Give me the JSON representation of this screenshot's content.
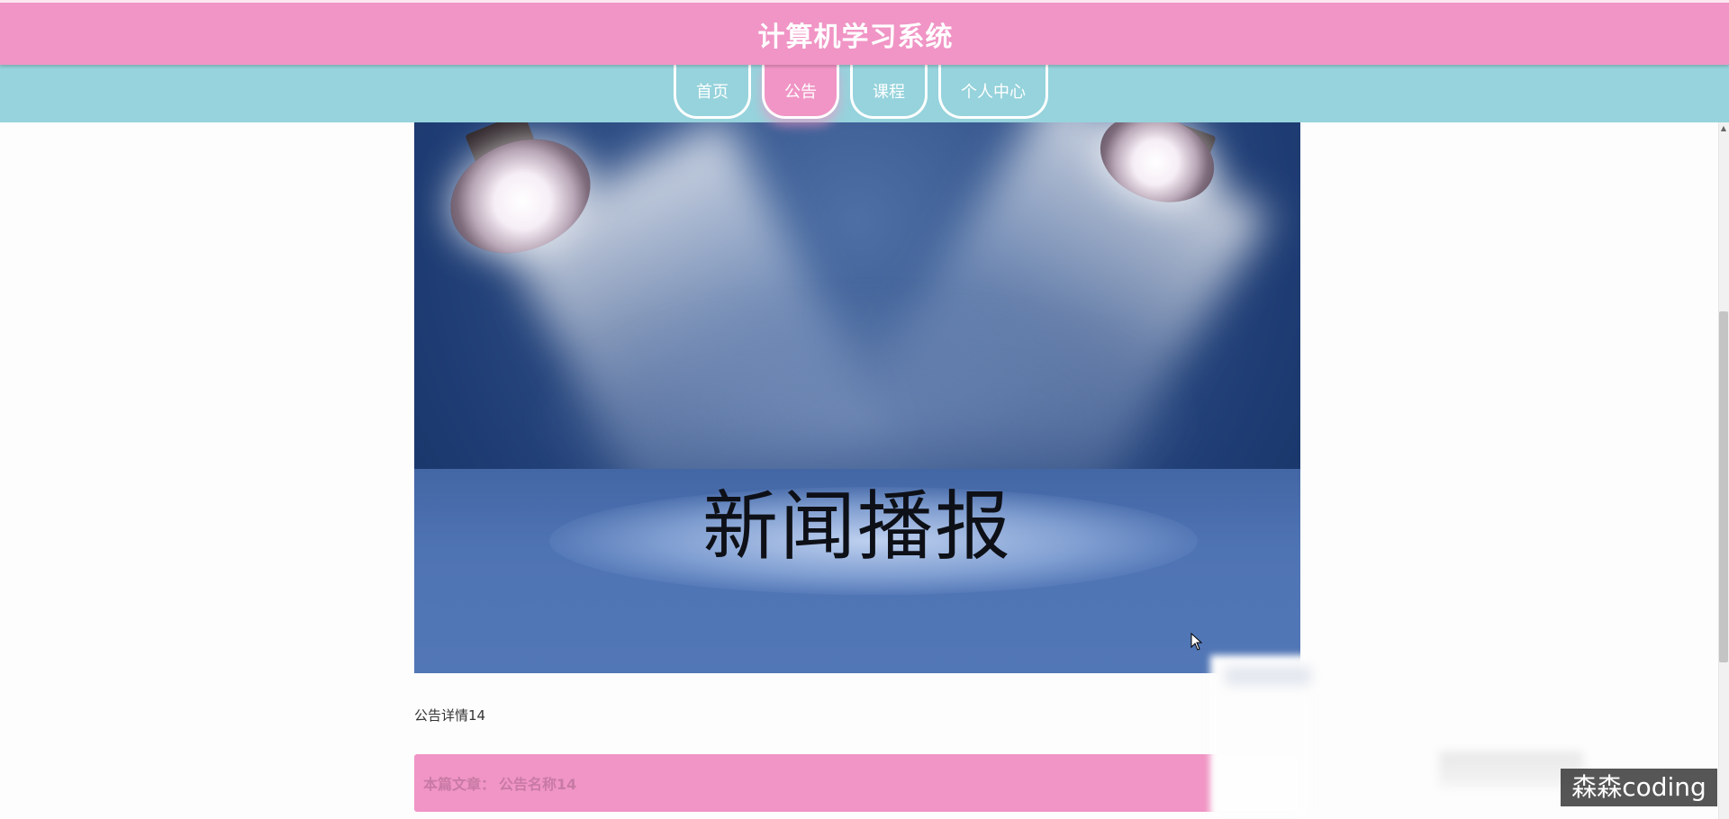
{
  "header": {
    "site_title": "计算机学习系统"
  },
  "nav": {
    "items": [
      {
        "label": "首页"
      },
      {
        "label": "公告"
      },
      {
        "label": "课程"
      },
      {
        "label": "个人中心"
      }
    ],
    "active_index": 1
  },
  "banner": {
    "text": "新闻播报"
  },
  "content": {
    "detail_text": "公告详情14",
    "article_label": "本篇文章：",
    "article_name": "公告名称14"
  },
  "watermark": {
    "text": "森森coding"
  },
  "colors": {
    "header_pink": "#f095c5",
    "nav_teal": "#96d3dc",
    "text_dark": "#333333"
  }
}
